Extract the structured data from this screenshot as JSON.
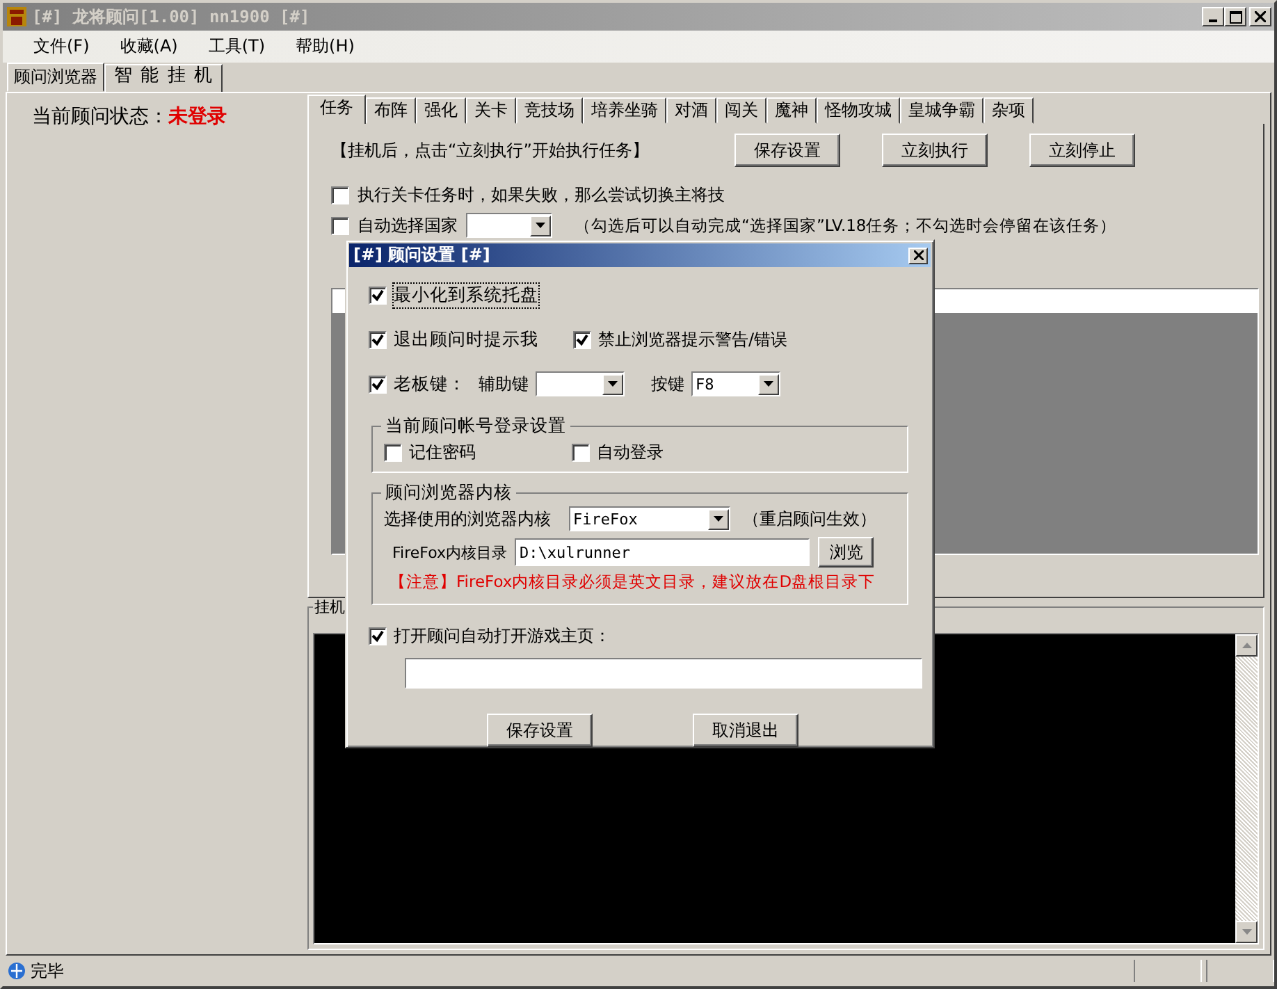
{
  "window": {
    "title": "[#] 龙将顾问[1.00] nn1900 [#]"
  },
  "menu": [
    "文件(F)",
    "收藏(A)",
    "工具(T)",
    "帮助(H)"
  ],
  "outer_tabs": [
    {
      "label": "顾问浏览器",
      "selected": false
    },
    {
      "label": "智 能 挂 机",
      "selected": true
    }
  ],
  "status": {
    "label": "当前顾问状态：",
    "value": "未登录"
  },
  "task_tabs": [
    {
      "label": "任务",
      "selected": true
    },
    {
      "label": "布阵",
      "selected": false
    },
    {
      "label": "强化",
      "selected": false
    },
    {
      "label": "关卡",
      "selected": false
    },
    {
      "label": "竞技场",
      "selected": false
    },
    {
      "label": "培养坐骑",
      "selected": false
    },
    {
      "label": "对酒",
      "selected": false
    },
    {
      "label": "闯关",
      "selected": false
    },
    {
      "label": "魔神",
      "selected": false
    },
    {
      "label": "怪物攻城",
      "selected": false
    },
    {
      "label": "皇城争霸",
      "selected": false
    },
    {
      "label": "杂项",
      "selected": false
    }
  ],
  "task_panel": {
    "hint": "【挂机后，点击“立刻执行”开始执行任务】",
    "buttons": [
      "保存设置",
      "立刻执行",
      "立刻停止"
    ],
    "options": [
      {
        "kind": "checkbox",
        "label": "执行关卡任务时，如果失败，那么尝试切换主将技",
        "checked": false
      },
      {
        "kind": "checkbox_select",
        "label": "自动选择国家",
        "checked": false,
        "note": "（勾选后可以自动完成“选择国家”LV.18任务；不勾选时会停留在该任务）"
      }
    ]
  },
  "log_group": {
    "label": "挂机"
  },
  "dialog": {
    "title": "[#] 顾问设置 [#]",
    "minimize": {
      "label": "最小化到系统托盘",
      "checked": true
    },
    "exit_prompt": {
      "label": "退出顾问时提示我",
      "checked": true
    },
    "block_alerts": {
      "label": "禁止浏览器提示警告/错误",
      "checked": true
    },
    "boss_key": {
      "label": "老板键：",
      "checked": true,
      "modifier_label": "辅助键",
      "key_label": "按键",
      "key_value": "F8"
    },
    "login_group": {
      "title": "当前顾问帐号登录设置",
      "options": [
        {
          "label": "记住密码",
          "checked": false
        },
        {
          "label": "自动登录",
          "checked": false
        }
      ]
    },
    "browser_group": {
      "title": "顾问浏览器内核",
      "engine_label": "选择使用的浏览器内核",
      "engine_value": "FireFox",
      "engine_note": "（重启顾问生效）",
      "dir_label": "FireFox内核目录",
      "dir_value": "D:\\xulrunner",
      "browse_button": "浏览",
      "warning": "【注意】FireFox内核目录必须是英文目录，建议放在D盘根目录下"
    },
    "homepage": {
      "label": "打开顾问自动打开游戏主页：",
      "checked": true
    },
    "buttons": [
      "保存设置",
      "取消退出"
    ]
  },
  "status_bar": {
    "text": "完毕"
  }
}
